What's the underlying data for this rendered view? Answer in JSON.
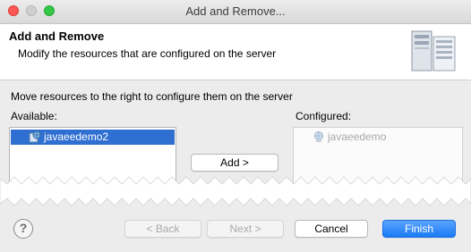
{
  "window": {
    "title": "Add and Remove..."
  },
  "banner": {
    "title": "Add and Remove",
    "description": "Modify the resources that are configured on the server"
  },
  "instruction": "Move resources to the right to configure them on the server",
  "available": {
    "label": "Available:",
    "items": [
      {
        "label": "javaeedemo2",
        "selected": true,
        "icon": "web-project-icon"
      }
    ]
  },
  "configured": {
    "label": "Configured:",
    "items": [
      {
        "label": "javaeedemo",
        "disabled": true,
        "icon": "web-module-icon"
      }
    ]
  },
  "buttons": {
    "add": "Add >",
    "back": "< Back",
    "next": "Next >",
    "cancel": "Cancel",
    "finish": "Finish",
    "help": "?"
  },
  "colors": {
    "selection": "#2f6fd1",
    "finish": "#1a7cf5",
    "close": "#fc5753",
    "maximize": "#34c748"
  }
}
